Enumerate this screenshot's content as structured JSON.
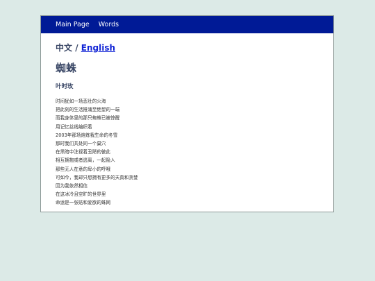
{
  "nav": {
    "items": [
      "Main Page",
      "Words"
    ]
  },
  "lang": {
    "current": "中文",
    "separator": " / ",
    "other": "English"
  },
  "poem": {
    "title": "蜘蛛",
    "author": "叶时玫",
    "lines": [
      "时间犹如一场悲壮的火海",
      "把此刻的生活推涌至绝望的一端",
      "而我身体里的那只蜘蛛已被惊醒",
      "用记忆丝线编织着",
      "2003年那场熔炼我生命的冬雪",
      "那时我们共处同一个巢穴",
      "在黑暗中注视着丑陋的彼此",
      "相互拥抱或者逃离，一起隐入",
      "那些无人在意的卑小的呼哦",
      "可如今，我却只想拥有更多的天真和贪婪",
      "因为我依然相信",
      "在这冰冷且空旷的世界里",
      "命运是一张贴和爱欲的蛛网"
    ]
  },
  "colors": {
    "background": "#dceae7",
    "navbar": "#001a96",
    "link": "#1326d6",
    "heading": "#3a4766"
  }
}
